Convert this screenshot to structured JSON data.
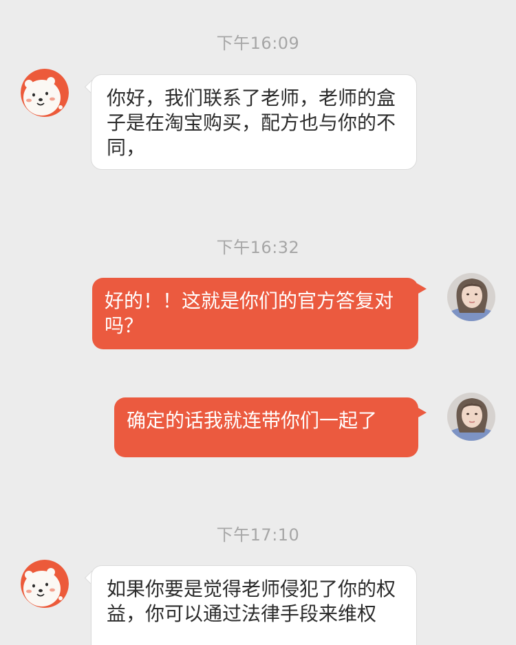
{
  "messages": [
    {
      "timestamp": "下午16:09",
      "sender": "merchant",
      "avatar": "bear-avatar-icon",
      "text": "你好，我们联系了老师，老师的盒子是在淘宝购买，配方也与你的不同，"
    },
    {
      "timestamp": "下午16:32",
      "sender": "user",
      "avatar": "user-avatar-photo",
      "text": "好的！！这就是你们的官方答复对吗？"
    },
    {
      "timestamp": "",
      "sender": "user",
      "avatar": "user-avatar-photo",
      "text": "确定的话我就连带你们一起了"
    },
    {
      "timestamp": "下午17:10",
      "sender": "merchant",
      "avatar": "bear-avatar-icon",
      "text": "如果你要是觉得老师侵犯了你的权益，你可以通过法律手段来维权"
    }
  ],
  "colors": {
    "background": "#ececec",
    "outgoing_bubble": "#eb5a3f",
    "incoming_bubble": "#ffffff",
    "timestamp_text": "#a6a6a6",
    "merchant_avatar_bg": "#ec5a3a"
  }
}
